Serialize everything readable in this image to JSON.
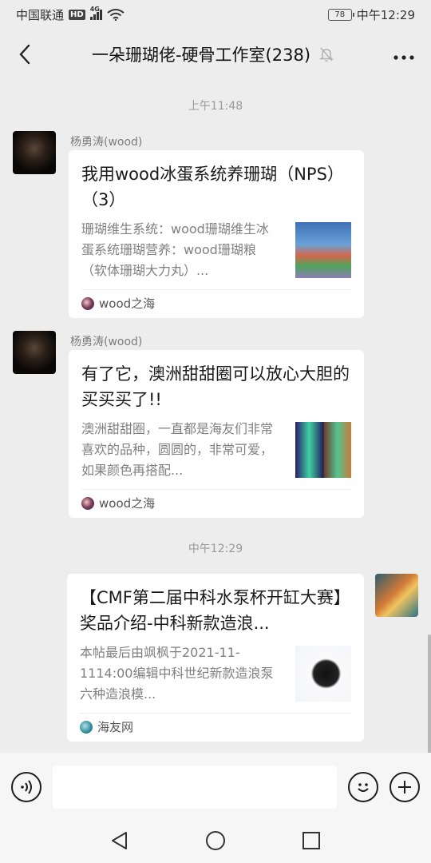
{
  "status_bar": {
    "carrier": "中国联通",
    "hd": "HD",
    "network": "4G",
    "battery": "78",
    "time": "中午12:29"
  },
  "header": {
    "title": "一朵珊瑚佬-硬骨工作室(238)",
    "back_icon": "chevron-left-icon",
    "mute_icon": "bell-off-icon",
    "more_icon": "ellipsis-icon"
  },
  "messages": {
    "time_1": "上午11:48",
    "time_2": "中午12:29",
    "items": [
      {
        "sender": "杨勇涛(wood)",
        "title": "我用wood冰蛋系统养珊瑚（NPS）（3）",
        "description": "珊瑚维生系统：wood珊瑚维生冰蛋系统珊瑚营养：wood珊瑚粮（软体珊瑚大力丸）...",
        "source": "wood之海"
      },
      {
        "sender": "杨勇涛(wood)",
        "title": "有了它，澳洲甜甜圈可以放心大胆的买买买了!!",
        "description": "澳洲甜甜圈，一直都是海友们非常喜欢的品种，圆圆的，非常可爱，如果颜色再搭配...",
        "source": "wood之海"
      },
      {
        "title": "【CMF第二届中科水泵杯开缸大赛】奖品介绍-中科新款造浪...",
        "description": "本帖最后由飒枫于2021-11-1114:00编辑中科世纪新款造浪泵六种造浪模...",
        "source": "海友网"
      }
    ]
  },
  "input_bar": {
    "placeholder": "",
    "voice_icon": "voice-icon",
    "emoji_icon": "emoji-icon",
    "plus_icon": "plus-icon"
  },
  "nav_bar": {
    "back_icon": "triangle-back-icon",
    "home_icon": "circle-home-icon",
    "recents_icon": "square-recents-icon"
  }
}
